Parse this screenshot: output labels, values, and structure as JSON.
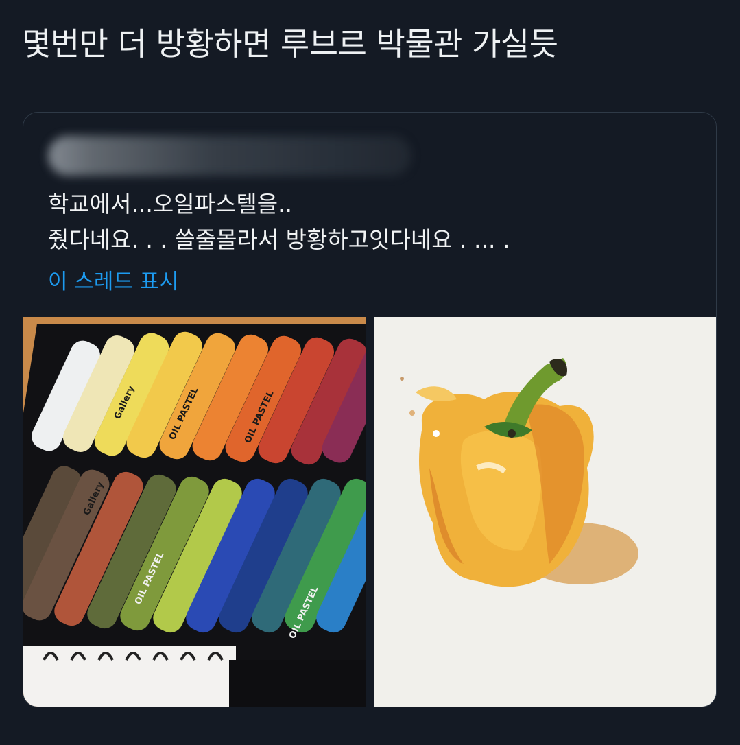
{
  "post": {
    "title": "몇번만 더 방황하면 루브르 박물관 가실듯"
  },
  "quoted_tweet": {
    "text_lines": [
      "학교에서...오일파스텔을..",
      "줬다네요. . . 쓸줄몰라서 방황하고잇다네요 . ... ."
    ],
    "show_thread_label": "이 스레드 표시"
  },
  "media": {
    "pastel_labels": [
      "OIL PASTEL",
      "Gallery",
      "OIL PASTEL",
      "Gallery",
      "OIL PASTEL",
      "OIL PASTEL"
    ]
  },
  "colors": {
    "background": "#141a24",
    "link": "#1d9bf0",
    "card_border": "#2f3a47"
  }
}
